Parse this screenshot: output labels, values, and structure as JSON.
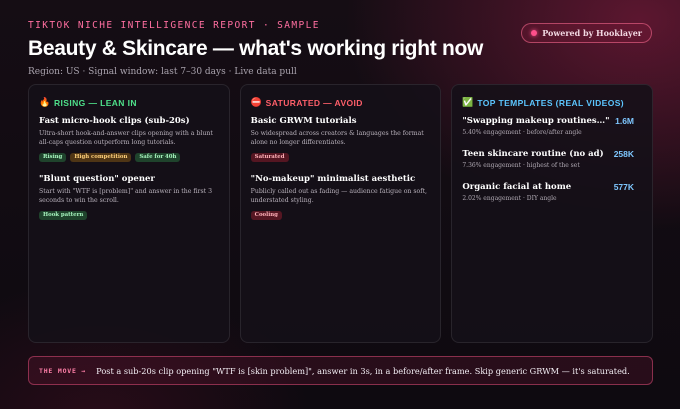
{
  "header": {
    "eyebrow": "TIKTOK NICHE INTELLIGENCE REPORT · SAMPLE",
    "title": "Beauty & Skincare — what's working right now",
    "subtitle": "Region: US · Signal window: last 7–30 days · Live data pull",
    "powered_by": "Powered by Hooklayer"
  },
  "colors": {
    "rising": "#4ee08a",
    "saturated": "#ff5f6a",
    "top": "#5cc6ff",
    "accent": "#ff6fa0"
  },
  "rising": {
    "icon": "fire-icon",
    "heading": "RISING — LEAN IN",
    "items": [
      {
        "title": "Fast micro-hook clips (sub-20s)",
        "desc": "Ultra-short hook-and-answer clips opening with a blunt all-caps question outperform long tutorials.",
        "tags": [
          "Rising",
          "High competition",
          "Safe for 40h"
        ]
      },
      {
        "title": "\"Blunt question\" opener",
        "desc": "Start with \"WTF is [problem]\" and answer in the first 3 seconds to win the scroll.",
        "tags": [
          "Hook pattern"
        ]
      }
    ]
  },
  "saturated": {
    "icon": "no-entry-icon",
    "heading": "SATURATED — AVOID",
    "items": [
      {
        "title": "Basic GRWM tutorials",
        "desc": "So widespread across creators & languages the format alone no longer differentiates.",
        "tags": [
          "Saturated"
        ]
      },
      {
        "title": "\"No-makeup\" minimalist aesthetic",
        "desc": "Publicly called out as fading — audience fatigue on soft, understated styling.",
        "tags": [
          "Cooling"
        ]
      }
    ]
  },
  "top_templates": {
    "icon": "check-icon",
    "heading": "TOP TEMPLATES (REAL VIDEOS)",
    "items": [
      {
        "title": "\"Swapping makeup routines…\"",
        "meta": "5.40% engagement · before/after angle",
        "views": "1.6M"
      },
      {
        "title": "Teen skincare routine (no ad)",
        "meta": "7.36% engagement · highest of the set",
        "views": "258K"
      },
      {
        "title": "Organic facial at home",
        "meta": "2.02% engagement · DIY angle",
        "views": "577K"
      }
    ]
  },
  "move": {
    "label": "THE MOVE →",
    "text": "Post a sub-20s clip opening \"WTF is [skin problem]\", answer in 3s, in a before/after frame. Skip generic GRWM — it's saturated."
  }
}
